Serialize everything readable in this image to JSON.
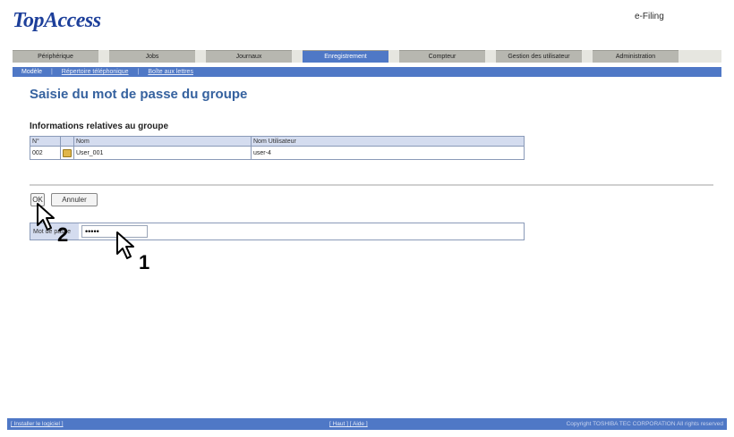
{
  "header": {
    "logo": "TopAccess",
    "efiling_link": "e-Filing"
  },
  "tabs": [
    {
      "label": "Périphérique",
      "active": false
    },
    {
      "label": "Jobs",
      "active": false
    },
    {
      "label": "Journaux",
      "active": false
    },
    {
      "label": "Enregistrement",
      "active": true
    },
    {
      "label": "Compteur",
      "active": false
    },
    {
      "label": "Gestion des utilisateur",
      "active": false
    },
    {
      "label": "Administration",
      "active": false
    }
  ],
  "subnav": {
    "item1": "Modèle",
    "item2": "Répertoire téléphonique",
    "item3": "Boîte aux lettres"
  },
  "page": {
    "title": "Saisie du mot de passe du groupe",
    "section_title": "Informations relatives au groupe"
  },
  "table": {
    "headers": [
      "N°",
      "",
      "Nom",
      "Nom Utilisateur"
    ],
    "rows": [
      {
        "number": "002",
        "name": "User_001",
        "user": "user-4"
      }
    ]
  },
  "buttons": {
    "ok": "OK",
    "cancel": "Annuler"
  },
  "password": {
    "label": "Mot de passe",
    "value": "•••••"
  },
  "callouts": {
    "one": "1",
    "two": "2"
  },
  "footer": {
    "left": "[ Installer le logiciel ]",
    "center": "[ Haut ] [ Aide ]",
    "right": "Copyright TOSHIBA TEC CORPORATION All rights reserved"
  },
  "colors": {
    "accent": "#4f78c6",
    "title": "#36629f",
    "header_bg": "#d4dcef"
  }
}
